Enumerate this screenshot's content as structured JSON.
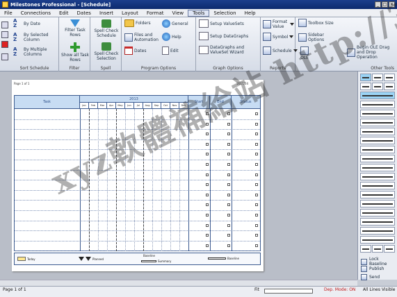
{
  "window": {
    "title": "Milestones Professional - [Schedule]",
    "controls": [
      "_",
      "□",
      "✕"
    ]
  },
  "menu": [
    "File",
    "Connections",
    "Edit",
    "Dates",
    "Insert",
    "Layout",
    "Format",
    "View",
    "Tools",
    "Selection",
    "Help"
  ],
  "active_menu": "Tools",
  "ribbon": {
    "sort": {
      "label": "Sort Schedule",
      "by_date": "By Date",
      "by_selected": "By Selected Column",
      "by_multiple": "By Multiple Columns"
    },
    "filter": {
      "label": "Filter",
      "filter_task_rows": "Filter Task Rows",
      "show_all": "Show all Task Rows"
    },
    "spell": {
      "label": "Spell",
      "spell_schedule": "Spell Check Schedule",
      "spell_selection": "Spell Check Selection"
    },
    "program_options": {
      "label": "Program Options",
      "folders": "Folders",
      "files": "Files and Automation",
      "dates": "Dates",
      "general": "General",
      "help": "Help",
      "edit": "Edit"
    },
    "graph": {
      "label": "Graph Options",
      "setup_valuesets": "Setup ValueSets",
      "setup_datagraphs": "Setup DataGraphs",
      "wizard": "DataGraphs and ValueSet Wizard"
    },
    "reports": {
      "label": "Reports",
      "format_value": "Format Value",
      "symbol": "Symbol",
      "schedule": "Schedule"
    },
    "other": {
      "label": "Other Tools",
      "toolbox_size": "Toolbox Size",
      "sidebar_options": "Sidebar Options",
      "begin_ole": "Begin OLE Drag and Drop Operation",
      "ole_short": "OLE"
    }
  },
  "schedule": {
    "page_label": "Page 1 of 1",
    "date_label": "2011/04",
    "columns": {
      "task": "Task",
      "start": "Start",
      "end": "End",
      "status": "Status"
    },
    "year": "2013",
    "months": [
      "Jan",
      "Feb",
      "Mar",
      "Apr",
      "May",
      "Jun",
      "Jul",
      "Aug",
      "Sep",
      "Oct",
      "Nov",
      "Dec"
    ]
  },
  "legend": {
    "today": "Today",
    "planned": "Planned",
    "baseline": "Baseline",
    "summary": "Summary",
    "baseline_date": "Baseline"
  },
  "sidebar": {
    "lock_baseline": "Lock Baseline",
    "publish": "Publish",
    "send": "Send"
  },
  "status": {
    "page": "Page 1 of 1",
    "fit": "Fit",
    "dep_mode": "Dep. Mode: ON",
    "all_lines": "All Lines Visible"
  },
  "watermark": "xyz軟體補給站 http://31.to",
  "colors": {
    "header_fill": "#c7dcf3",
    "grid_line": "#3b5a8f",
    "dep_mode": "#c01818"
  }
}
